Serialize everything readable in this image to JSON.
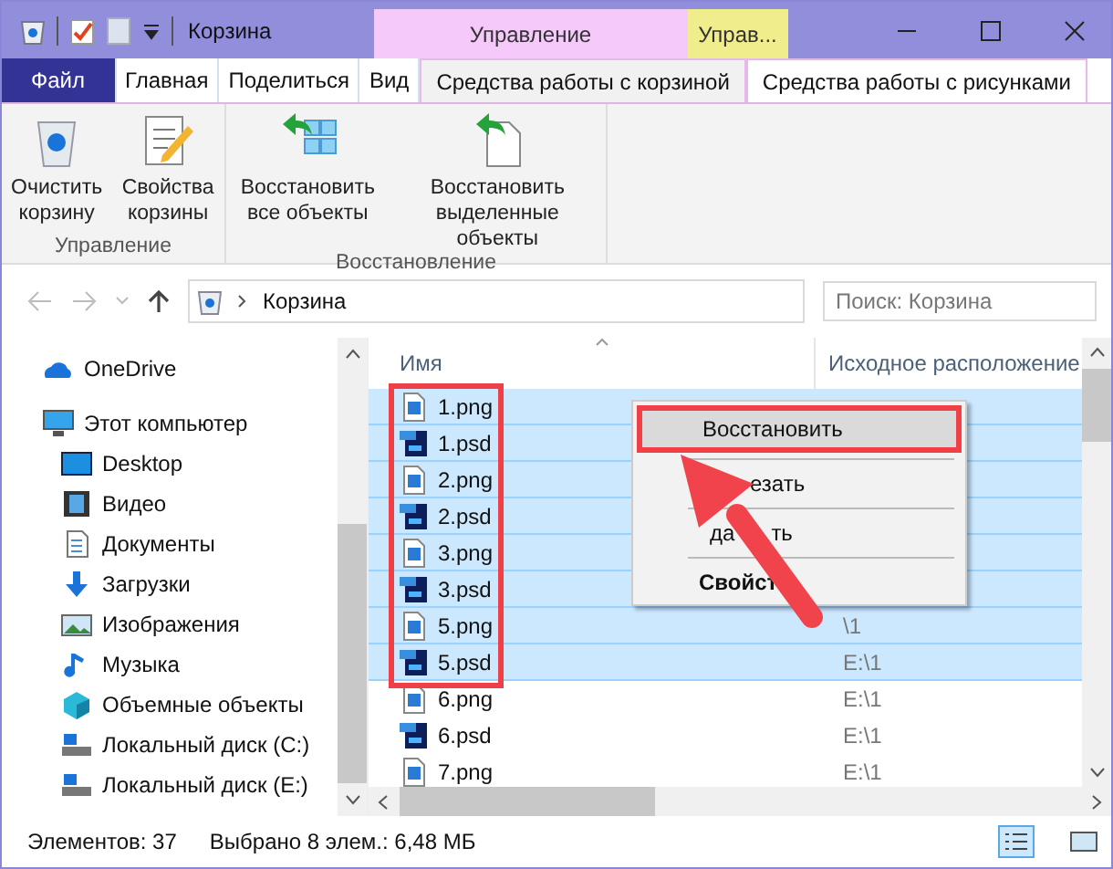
{
  "window": {
    "title": "Корзина",
    "context_tabs": [
      {
        "label": "Управление",
        "color": "#f5c9fa"
      },
      {
        "label": "Управ...",
        "color": "#f0ee8c"
      }
    ]
  },
  "ribbon_tabs": [
    {
      "label": "Файл",
      "kind": "file",
      "selected": false
    },
    {
      "label": "Главная",
      "kind": "tab",
      "selected": false
    },
    {
      "label": "Поделиться",
      "kind": "tab",
      "selected": false
    },
    {
      "label": "Вид",
      "kind": "tab",
      "selected": false
    },
    {
      "label": "Средства работы с корзиной",
      "kind": "tab",
      "selected": true
    },
    {
      "label": "Средства работы с рисунками",
      "kind": "tab",
      "selected": false
    }
  ],
  "ribbon_groups": [
    {
      "label": "Управление",
      "buttons": [
        {
          "label": "Очистить корзину",
          "kind": "bin"
        },
        {
          "label": "Свойства корзины",
          "kind": "props"
        }
      ]
    },
    {
      "label": "Восстановление",
      "buttons": [
        {
          "label": "Восстановить все объекты",
          "kind": "all"
        },
        {
          "label": "Восстановить выделенные объекты",
          "kind": "selection"
        }
      ]
    }
  ],
  "address": {
    "path": "Корзина",
    "search_placeholder": "Поиск: Корзина"
  },
  "nav_pane": [
    {
      "label": "OneDrive",
      "kind": "cloud"
    },
    {
      "label": "Этот компьютер",
      "kind": "pc"
    },
    {
      "label": "Desktop",
      "kind": "desktop"
    },
    {
      "label": "Видео",
      "kind": "video"
    },
    {
      "label": "Документы",
      "kind": "docs"
    },
    {
      "label": "Загрузки",
      "kind": "downloads"
    },
    {
      "label": "Изображения",
      "kind": "images"
    },
    {
      "label": "Музыка",
      "kind": "music"
    },
    {
      "label": "Объемные объекты",
      "kind": "objects"
    },
    {
      "label": "Локальный диск (C:)",
      "kind": "drive"
    },
    {
      "label": "Локальный диск (E:)",
      "kind": "drive"
    }
  ],
  "table": {
    "columns": [
      "Имя",
      "Исходное расположение"
    ],
    "rows": [
      {
        "name": "1.png",
        "kind": "image",
        "selected": true
      },
      {
        "name": "1.psd",
        "kind": "photoshop",
        "selected": true
      },
      {
        "name": "2.png",
        "kind": "image",
        "selected": true
      },
      {
        "name": "2.psd",
        "kind": "photoshop",
        "selected": true
      },
      {
        "name": "3.png",
        "kind": "image",
        "selected": true
      },
      {
        "name": "3.psd",
        "kind": "photoshop",
        "selected": true
      },
      {
        "name": "5.png",
        "kind": "image",
        "selected": true,
        "location": "\\1"
      },
      {
        "name": "5.psd",
        "kind": "photoshop",
        "selected": true,
        "location": "E:\\1"
      },
      {
        "name": "6.png",
        "kind": "image",
        "selected": false,
        "location": "E:\\1"
      },
      {
        "name": "6.psd",
        "kind": "photoshop",
        "selected": false,
        "location": "E:\\1"
      },
      {
        "name": "7.png",
        "kind": "image",
        "selected": false,
        "location": "E:\\1"
      }
    ]
  },
  "context_menu": [
    {
      "label_parts": [
        "Восстановить"
      ],
      "selected": true,
      "bold": false
    },
    {
      "label_parts": [
        "езать"
      ],
      "selected": false,
      "bold": false
    },
    {
      "label_parts": [
        "да",
        "ть"
      ],
      "selected": false,
      "bold": false
    },
    {
      "label_parts": [
        "Свойст"
      ],
      "selected": false,
      "bold": true
    }
  ],
  "status_bar": {
    "count": "Элементов: 37",
    "selection": "Выбрано 8 элем.: 6,48 МБ"
  }
}
